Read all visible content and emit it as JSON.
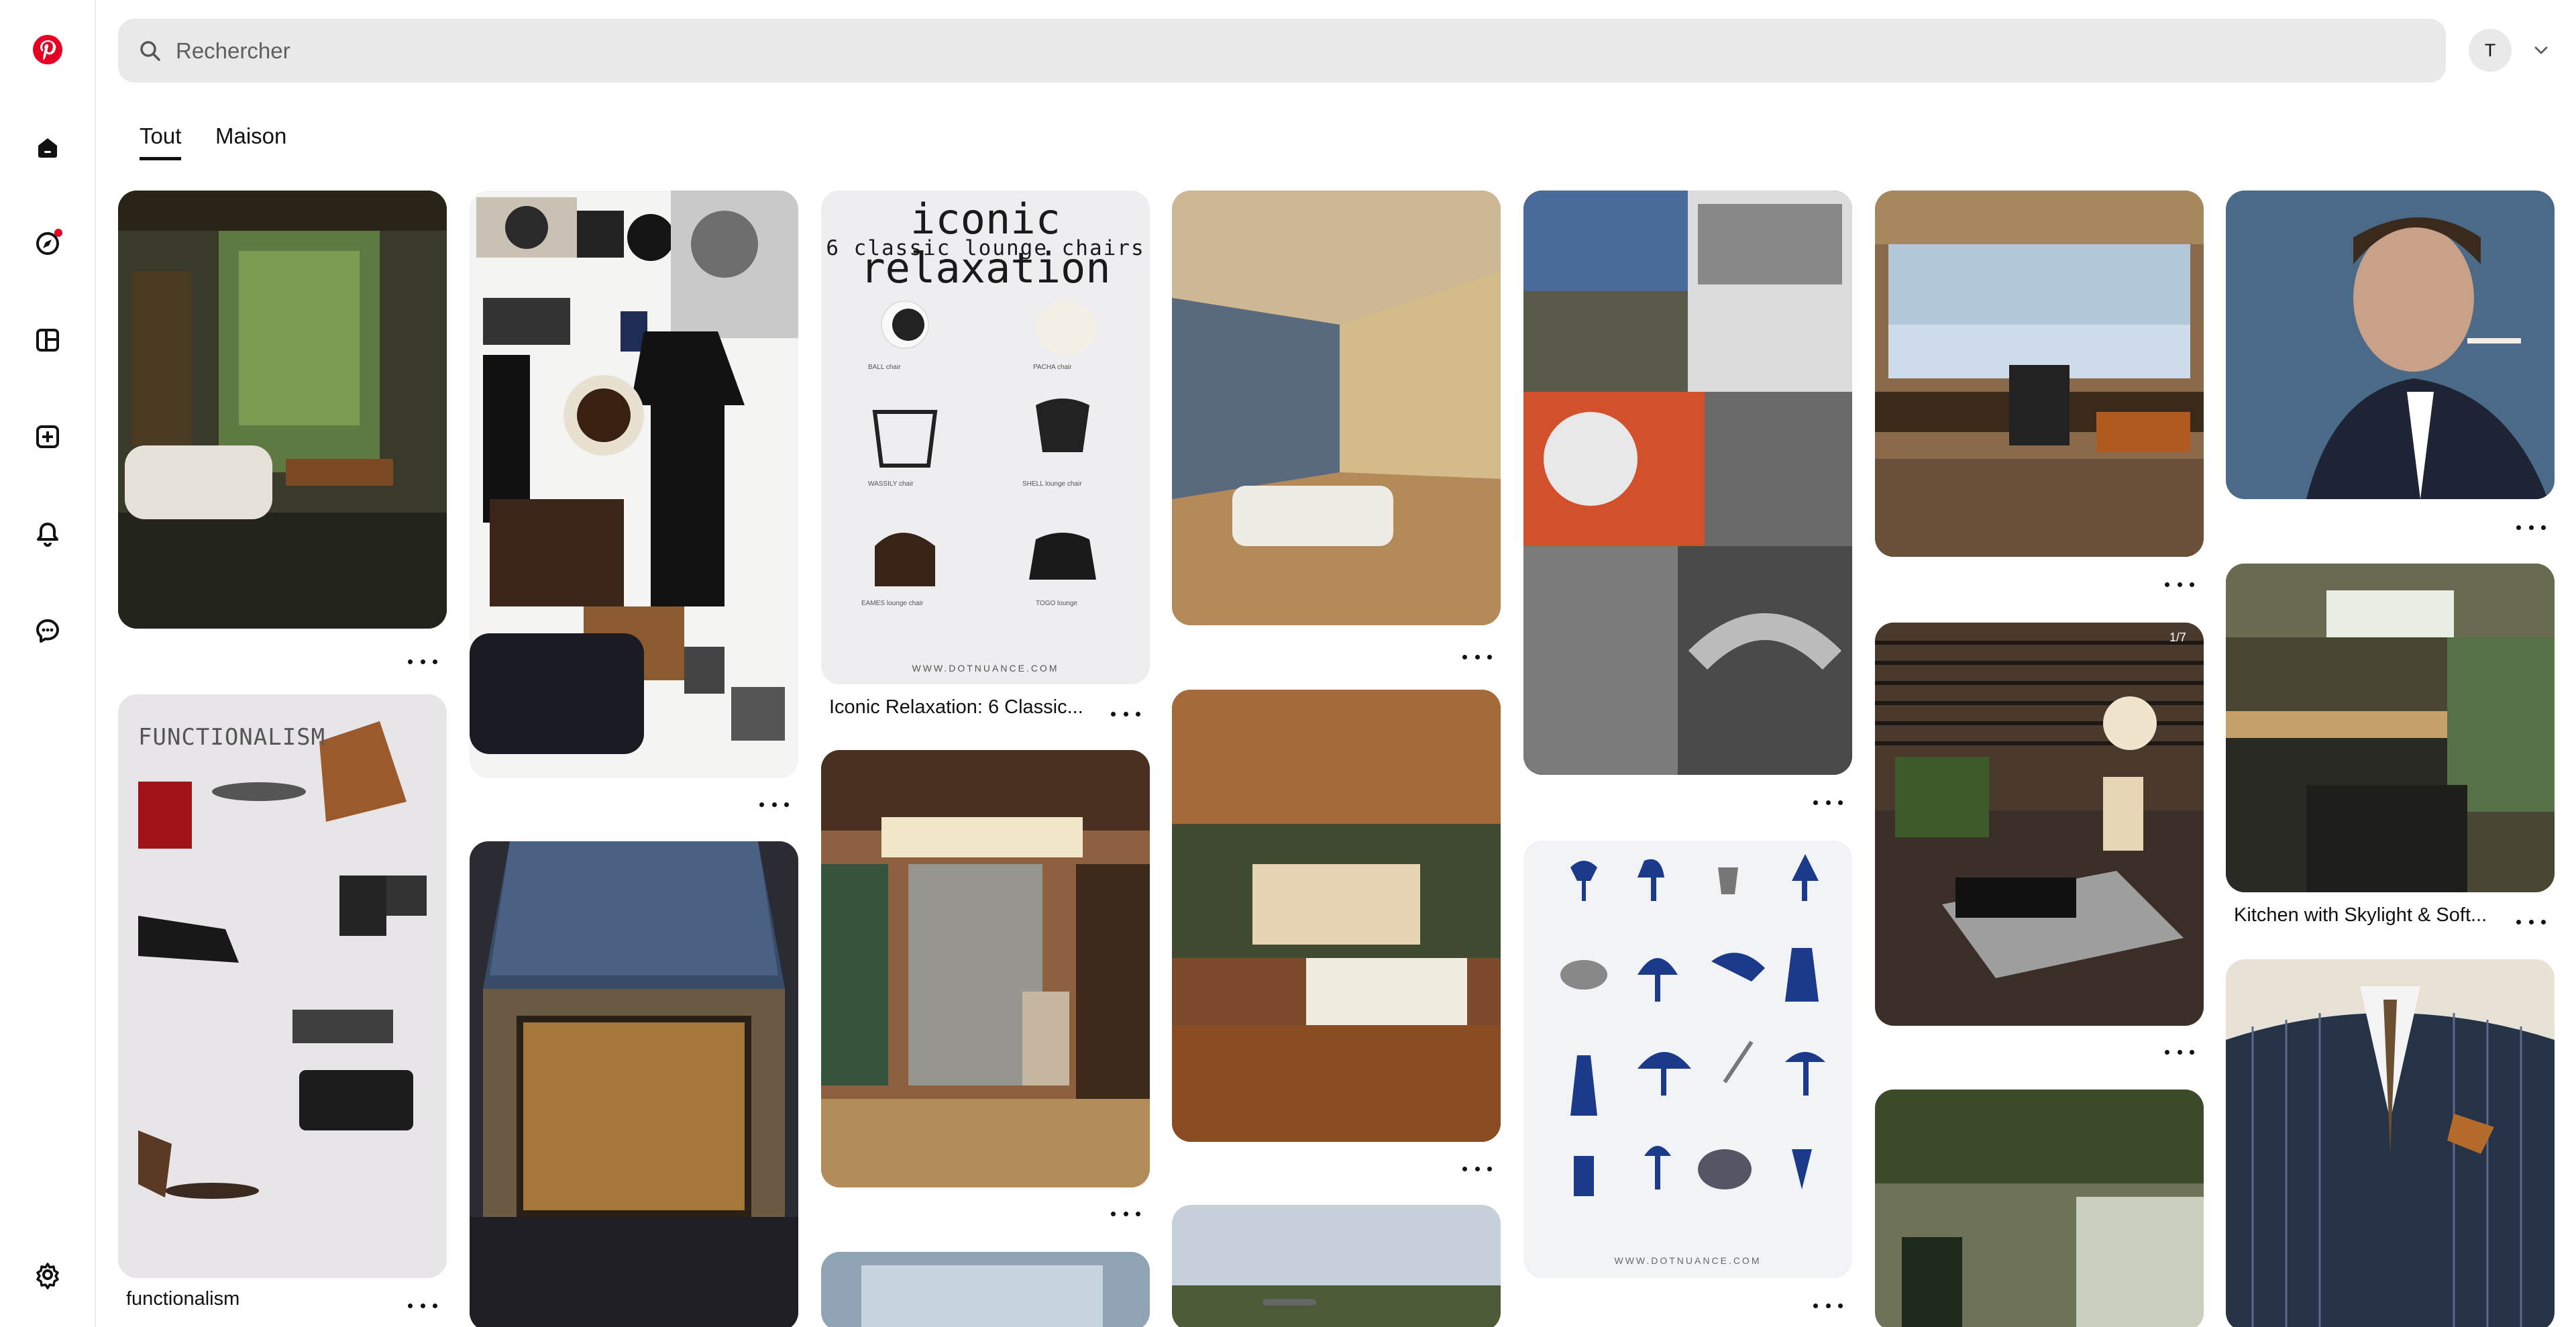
{
  "app": {
    "brand_color": "#e60023"
  },
  "nav": {
    "logo": "pinterest-logo",
    "items": [
      {
        "name": "home",
        "icon": "home-icon"
      },
      {
        "name": "explore",
        "icon": "compass-icon",
        "has_notification": true
      },
      {
        "name": "boards",
        "icon": "board-icon"
      },
      {
        "name": "create",
        "icon": "plus-icon"
      },
      {
        "name": "notifications",
        "icon": "bell-icon"
      },
      {
        "name": "messages",
        "icon": "chat-icon"
      }
    ],
    "settings": {
      "icon": "gear-icon"
    }
  },
  "search": {
    "placeholder": "Rechercher",
    "value": ""
  },
  "account": {
    "initial": "T"
  },
  "tabs": [
    {
      "label": "Tout",
      "active": true
    },
    {
      "label": "Maison",
      "active": false
    }
  ],
  "pins": [
    {
      "id": "c1a",
      "theme": "glass office interior in forest"
    },
    {
      "id": "c1b",
      "title": "functionalism",
      "overlay_text": "FUNCTIONALISM"
    },
    {
      "id": "c2a",
      "theme": "menswear moodboard collage"
    },
    {
      "id": "c2b",
      "theme": "library building at dusk"
    },
    {
      "id": "c3a",
      "title": "Iconic Relaxation: 6 Classic...",
      "overlay_title": "iconic relaxation",
      "overlay_subtitle": "6 classic lounge chairs",
      "overlay_url": "WWW.DOTNUANCE.COM",
      "chairs": [
        {
          "name": "BALL chair"
        },
        {
          "name": "PACHA chair"
        },
        {
          "name": "WASSILY chair"
        },
        {
          "name": "SHELL lounge chair"
        },
        {
          "name": "EAMES lounge chair"
        },
        {
          "name": "TOGO lounge"
        }
      ]
    },
    {
      "id": "c3b",
      "theme": "man at desk in glass office"
    },
    {
      "id": "c4a",
      "theme": "mattress under glass roof"
    },
    {
      "id": "c4b",
      "theme": "wood-clad living room"
    },
    {
      "id": "c5a",
      "theme": "black and white sport collage"
    },
    {
      "id": "c5b",
      "theme": "blue lamps catalogue",
      "overlay_url": "WWW.DOTNUANCE.COM"
    },
    {
      "id": "c6a",
      "theme": "studio desk over city"
    },
    {
      "id": "c6b",
      "theme": "living room with checkered rug",
      "badge": "1/7"
    },
    {
      "id": "c6c",
      "theme": "plant filled atrium"
    },
    {
      "id": "c7a",
      "theme": "portrait man smoking"
    },
    {
      "id": "c7b",
      "title": "Kitchen with Skylight & Soft..."
    },
    {
      "id": "c7c",
      "theme": "pinstripe double-breasted suit"
    }
  ]
}
